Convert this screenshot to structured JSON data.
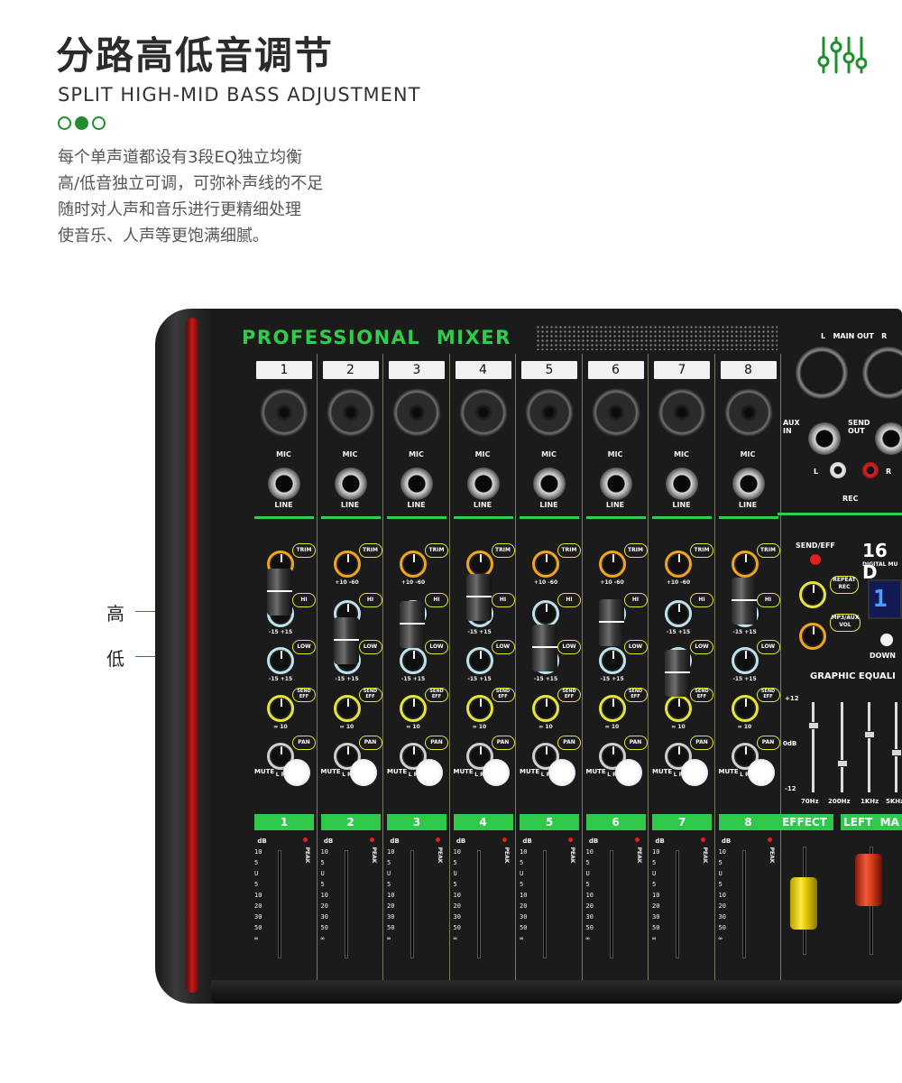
{
  "header": {
    "title": "分路高低音调节",
    "subtitle": "SPLIT HIGH-MID BASS ADJUSTMENT",
    "description": [
      "每个单声道都设有3段EQ独立均衡",
      "高/低音独立可调，可弥补声线的不足",
      "随时对人声和音乐进行更精细处理",
      "使音乐、人声等更饱满细腻。"
    ]
  },
  "callouts": {
    "high": "高",
    "low": "低"
  },
  "brand_color": "#1f8f2e",
  "icons": [
    "equalizer-icon"
  ],
  "mixer": {
    "brand": "PROFESSIONAL  MIXER",
    "channels": [
      "1",
      "2",
      "3",
      "4",
      "5",
      "6",
      "7",
      "8"
    ],
    "channel_strip_labels": {
      "mic": "MIC",
      "line": "LINE",
      "trim": "TRIM",
      "hi": "HI",
      "low": "LOW",
      "send_eff": "SEND EFF",
      "pan": "PAN",
      "mute": "MUTE",
      "trim_range": "+10  -60",
      "eq_range": "-15  +15",
      "send_range": "∞  10",
      "pan_range": "L   R",
      "db": "dB",
      "peak": "PEAK"
    },
    "fader_scale": [
      "10",
      "5",
      "U",
      "5",
      "10",
      "20",
      "30",
      "50",
      "∞"
    ],
    "right_section": {
      "main_out": "L   MAIN OUT   R",
      "aux_in": "AUX IN",
      "send_out": "SEND OUT",
      "rec": "REC",
      "rca_l": "L",
      "rca_r": "R",
      "send_eff": "SEND/EFF",
      "model": "16 D",
      "model_sub": "DIGITAL MU",
      "repeat_rec": "REPEAT REC",
      "mp3_aux_vol": "MP3/AUX VOL",
      "down": "DOWN",
      "display": "1",
      "graphic_eq": "GRAPHIC EQUALI",
      "eq_db": [
        "+12",
        "0dB",
        "-12"
      ],
      "eq_freqs": [
        "70Hz",
        "200Hz",
        "1KHz",
        "5KHz"
      ],
      "effect": "EFFECT",
      "left_main": "LEFT  MA"
    }
  }
}
